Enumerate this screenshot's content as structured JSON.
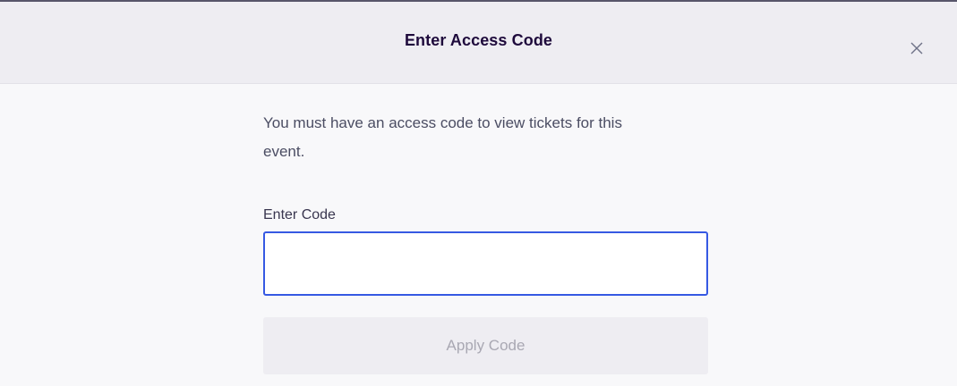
{
  "dialog": {
    "title": "Enter Access Code",
    "close_icon": "close-icon",
    "message": "You must have an access code to view tickets for this event.",
    "field_label": "Enter Code",
    "code_input": {
      "value": "",
      "placeholder": ""
    },
    "apply_button_label": "Apply Code",
    "apply_button_enabled": false
  },
  "colors": {
    "header_bg": "#eeedf2",
    "body_bg": "#f8f8fa",
    "input_focus_border": "#3659e3",
    "title_text": "#1e0a3c",
    "disabled_button_bg": "#eeedf2",
    "disabled_button_text": "#a9a8b3"
  }
}
